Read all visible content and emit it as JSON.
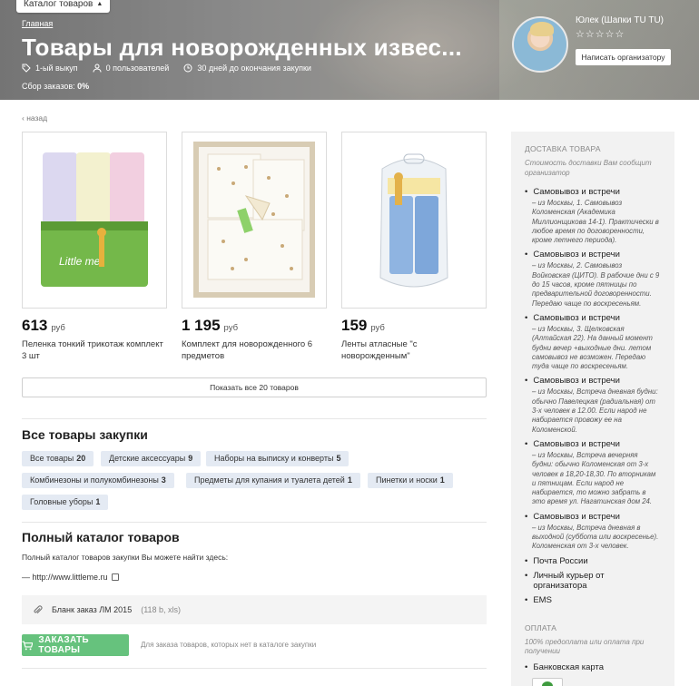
{
  "header": {
    "catalog_button": "Каталог товаров",
    "breadcrumb": "Главная",
    "title": "Товары для новорожденных извес...",
    "meta": {
      "issue": "1-ый выкуп",
      "users": "0 пользователей",
      "days_left": "30 дней до окончания закупки"
    },
    "orders_label": "Сбор заказов:",
    "orders_value": "0%",
    "organizer": {
      "name": "Юлек (Шапки TU TU)",
      "rating": 0,
      "rating_max": 5,
      "message_button": "Написать организатору"
    }
  },
  "main": {
    "back_link": "‹ назад",
    "products": [
      {
        "price": "613",
        "currency": "руб",
        "name": "Пеленка тонкий трикотаж комплект 3 шт"
      },
      {
        "price": "1 195",
        "currency": "руб",
        "name": "Комплект для новорожденного 6 предметов"
      },
      {
        "price": "159",
        "currency": "руб",
        "name": "Ленты атласные \"с новорожденным\""
      }
    ],
    "show_all_button": "Показать все 20 товаров",
    "all_products_title": "Все товары закупки",
    "tags": [
      {
        "label": "Все товары",
        "count": "20"
      },
      {
        "label": "Детские аксессуары",
        "count": "9"
      },
      {
        "label": "Наборы на выписку и конверты",
        "count": "5"
      },
      {
        "label": "Комбинезоны и полукомбинезоны",
        "count": "3"
      },
      {
        "label": "Предметы для купания и туалета детей",
        "count": "1"
      },
      {
        "label": "Пинетки и носки",
        "count": "1"
      },
      {
        "label": "Головные уборы",
        "count": "1"
      }
    ],
    "catalog_title": "Полный каталог товаров",
    "catalog_text": "Полный каталог товаров закупки Вы можете найти здесь:",
    "catalog_link": "— http://www.littleme.ru",
    "file_name": "Бланк заказ ЛМ 2015",
    "file_size": "(118 b, xls)",
    "order_button": "ЗАКАЗАТЬ ТОВАРЫ",
    "order_note": "Для заказа товаров, которых нет в каталоге закупки"
  },
  "sidebar": {
    "delivery_title": "ДОСТАВКА ТОВАРА",
    "delivery_sub": "Стоимость доставки Вам сообщит организатор",
    "delivery_items": [
      {
        "title": "Самовывоз и встречи",
        "desc": "– из Москвы, 1. Самовывоз Коломенская (Академика Миллионщикова 14-1). Практически в любое время по договоренности, кроме летнего периода)."
      },
      {
        "title": "Самовывоз и встречи",
        "desc": "– из Москвы, 2. Самовывоз Войковская (ЦИТО). В рабочие дни с 9 до 15 часов, кроме пятницы по предварительной договоренности. Передаю чаще по воскресеньям."
      },
      {
        "title": "Самовывоз и встречи",
        "desc": "– из Москвы, 3. Щелковская (Алтайская 22). На данный момент будни вечер +выходные дни. летом самовывоз не возможен. Передаю туда чаще по воскресеньям."
      },
      {
        "title": "Самовывоз и встречи",
        "desc": "– из Москвы, Встреча дневная будни: обычно Павелецкая (радиальная) от 3-х человек в 12.00. Если народ не набирается провожу ее на Коломенской."
      },
      {
        "title": "Самовывоз и встречи",
        "desc": "– из Москвы, Встреча вечерняя будни: обычно Коломенская от 3-х человек в 18,20-18,30. По вторникам и пятницам. Если народ не набирается, то можно забрать в это время ул. Нагатинская дом 24."
      },
      {
        "title": "Самовывоз и встречи",
        "desc": "– из Москвы, Встреча дневная в выходной (суббота или воскресенье). Коломенская от 3-х человек."
      },
      {
        "title": "Почта России",
        "desc": ""
      },
      {
        "title": "Личный курьер от организатора",
        "desc": ""
      },
      {
        "title": "EMS",
        "desc": ""
      }
    ],
    "payment_title": "ОПЛАТА",
    "payment_sub": "100% предоплата или оплата при получении",
    "payment_item": "Банковская карта"
  }
}
